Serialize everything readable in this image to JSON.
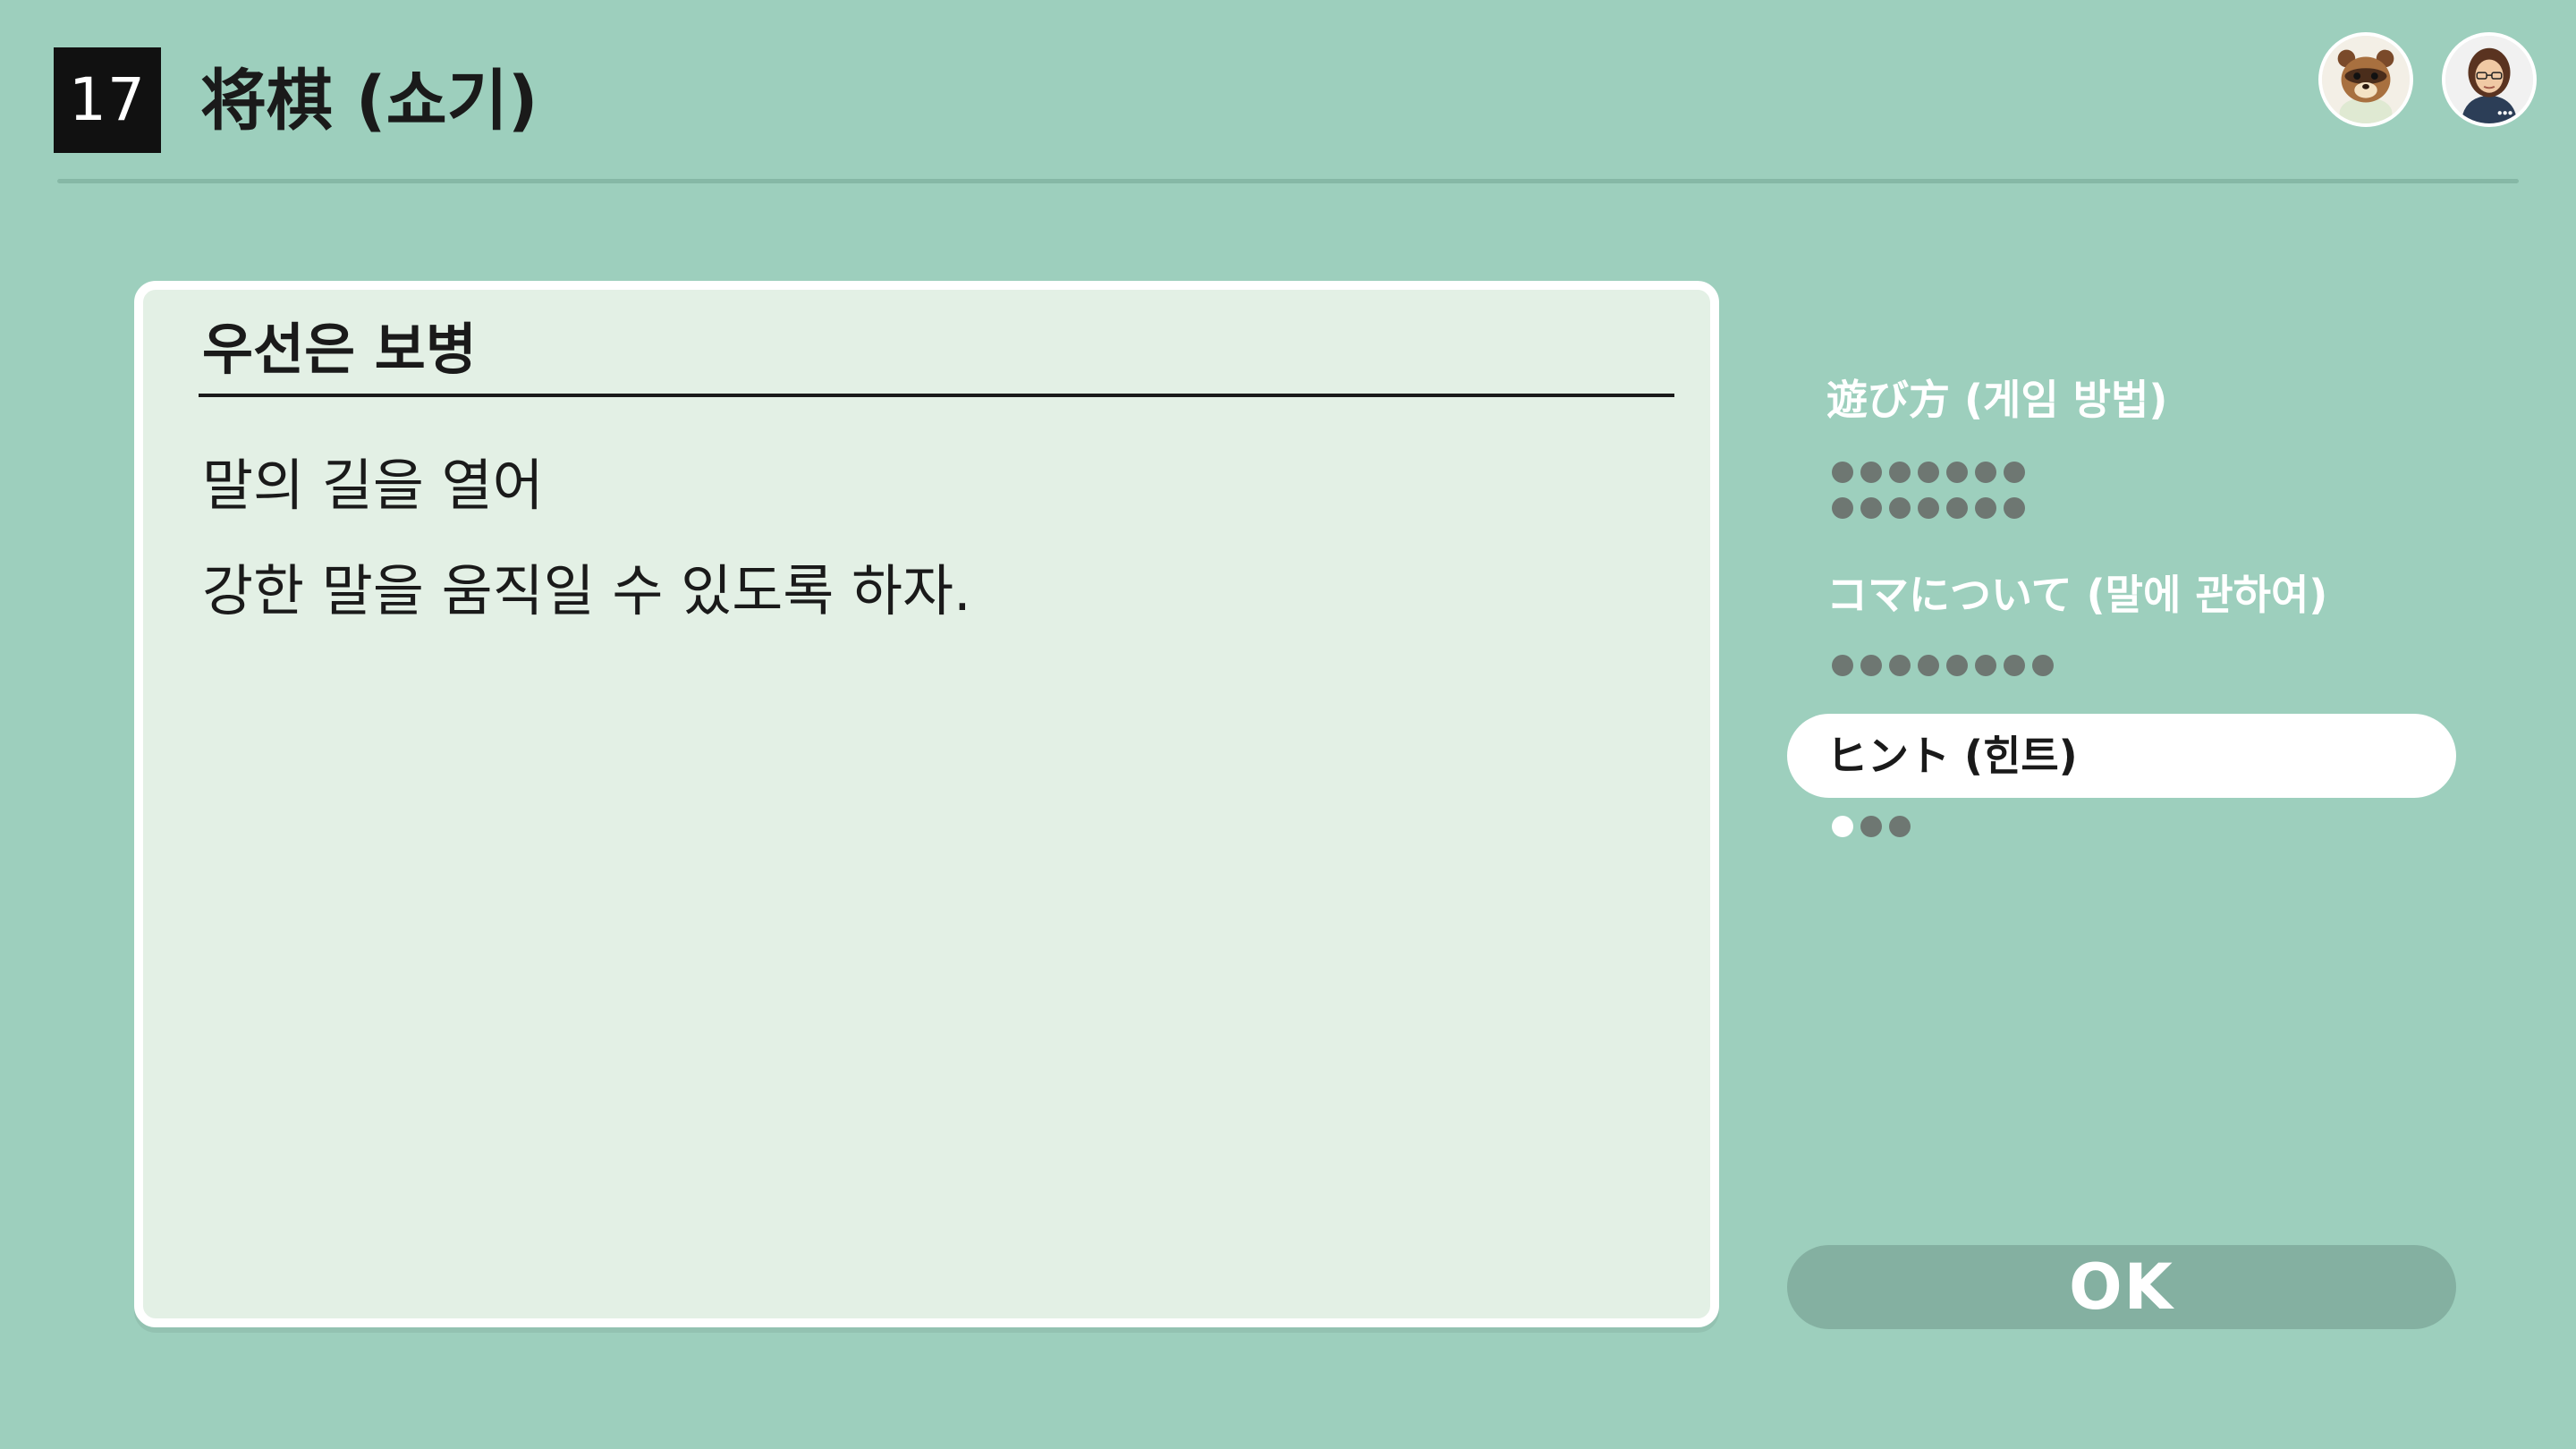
{
  "header": {
    "game_number": "17",
    "game_title": "将棋 (쇼기)",
    "avatars": [
      {
        "icon": "raccoon-character-avatar-icon"
      },
      {
        "icon": "user-avatar-icon"
      }
    ]
  },
  "hint": {
    "title": "우선은 보병",
    "lines": [
      "말의 길을 열어",
      "강한 말을 움직일 수 있도록 하자."
    ]
  },
  "menu": {
    "items": [
      {
        "label": "遊び方 (게임 방법)",
        "pages": 14,
        "current_page": 0,
        "selected": false
      },
      {
        "label": "コマについて (말에 관하여)",
        "pages": 8,
        "current_page": 0,
        "selected": false
      },
      {
        "label": "ヒント (힌트)",
        "pages": 3,
        "current_page": 1,
        "selected": true
      }
    ]
  },
  "ok_button": {
    "label": "OK"
  },
  "colors": {
    "background": "#9dcfbd",
    "panel": "#e3f0e5",
    "dot_inactive": "#6e7772",
    "dot_active": "#ffffff",
    "ok_button": "#84b0a1"
  }
}
